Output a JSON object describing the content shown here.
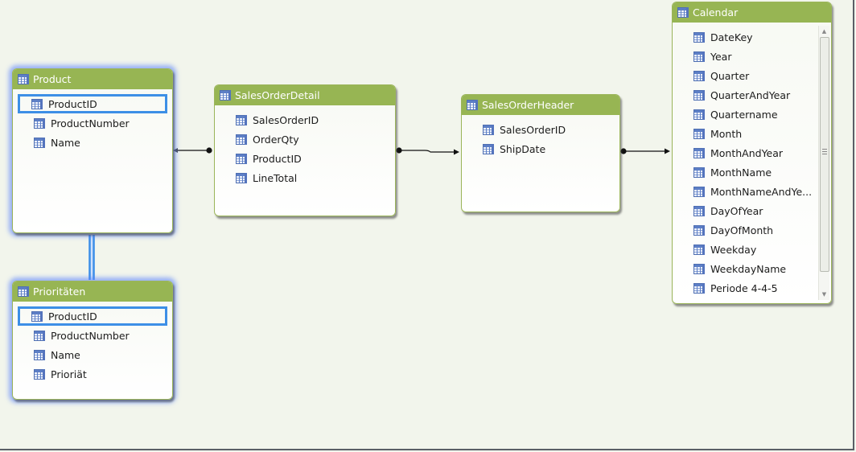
{
  "diagram": {
    "tables": [
      {
        "id": "product",
        "name": "Product",
        "selected": true,
        "columns": [
          "ProductID",
          "ProductNumber",
          "Name"
        ],
        "highlighted_column": "ProductID"
      },
      {
        "id": "prioritaeten",
        "name": "Prioritäten",
        "selected": true,
        "columns": [
          "ProductID",
          "ProductNumber",
          "Name",
          "Prioriät"
        ],
        "highlighted_column": "ProductID"
      },
      {
        "id": "salesorderdetail",
        "name": "SalesOrderDetail",
        "selected": false,
        "columns": [
          "SalesOrderID",
          "OrderQty",
          "ProductID",
          "LineTotal"
        ]
      },
      {
        "id": "salesorderheader",
        "name": "SalesOrderHeader",
        "selected": false,
        "columns": [
          "SalesOrderID",
          "ShipDate"
        ]
      },
      {
        "id": "calendar",
        "name": "Calendar",
        "selected": false,
        "columns": [
          "DateKey",
          "Year",
          "Quarter",
          "QuarterAndYear",
          "Quartername",
          "Month",
          "MonthAndYear",
          "MonthName",
          "MonthNameAndYe...",
          "DayOfYear",
          "DayOfMonth",
          "Weekday",
          "WeekdayName",
          "Periode 4-4-5"
        ],
        "scrollable": true
      }
    ],
    "relationships": [
      {
        "from": "SalesOrderDetail",
        "to": "Product",
        "selected": false
      },
      {
        "from": "SalesOrderDetail",
        "to": "SalesOrderHeader",
        "selected": false
      },
      {
        "from": "SalesOrderHeader",
        "to": "Calendar",
        "selected": false
      },
      {
        "from": "Prioritäten",
        "to": "Product",
        "selected": true
      }
    ],
    "colors": {
      "header": "#97b553",
      "selection": "#3d8fe6",
      "canvas": "#f2f5ec"
    }
  }
}
